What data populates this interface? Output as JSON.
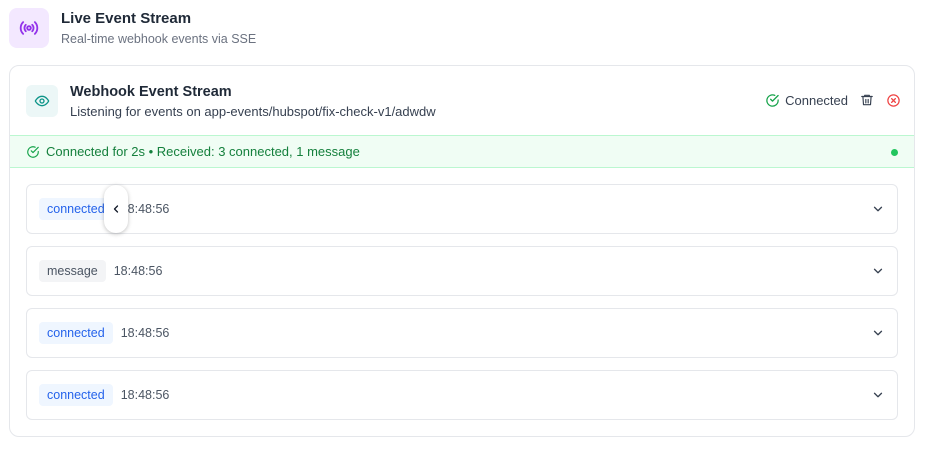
{
  "app": {
    "title": "Live Event Stream",
    "subtitle": "Real-time webhook events via SSE",
    "icon": "broadcast-icon",
    "accent_color": "#9333ea"
  },
  "stream": {
    "title": "Webhook Event Stream",
    "subtitle": "Listening for events on app-events/hubspot/fix-check-v1/adwdw",
    "status_label": "Connected",
    "status_color": "#22c55e",
    "banner_text": "Connected for 2s • Received: 3 connected, 1 message"
  },
  "events": [
    {
      "type": "connected",
      "time": "18:48:56"
    },
    {
      "type": "message",
      "time": "18:48:56"
    },
    {
      "type": "connected",
      "time": "18:48:56"
    },
    {
      "type": "connected",
      "time": "18:48:56"
    }
  ]
}
